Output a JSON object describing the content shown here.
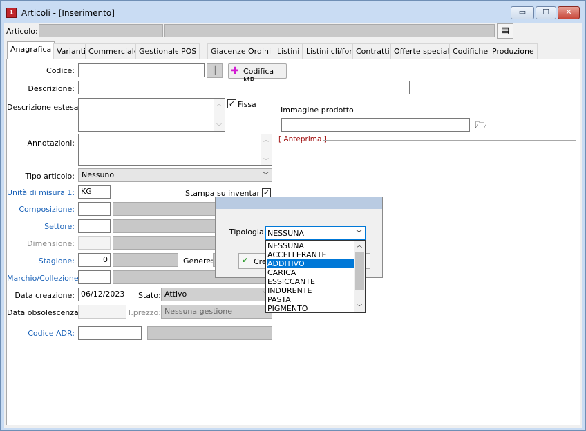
{
  "window": {
    "title": "Articoli - [Inserimento]",
    "app_icon": "1"
  },
  "window_controls": {
    "minimize": "▭",
    "maximize": "☐",
    "close": "✕"
  },
  "top_bar": {
    "label": "Articolo:",
    "list_icon": "clipboard-list-icon"
  },
  "tabs": [
    "Anagrafica",
    "Varianti",
    "Commerciale",
    "Gestionale",
    "POS",
    "Giacenze",
    "Ordini",
    "Listini",
    "Listini cli/for.",
    "Contratti",
    "Offerte speciali",
    "Codifiche",
    "Produzione"
  ],
  "form": {
    "codice_label": "Codice:",
    "codice_value": "",
    "codifica_btn": "Codifica MP",
    "descrizione_label": "Descrizione:",
    "descrizione_estesa_label": "Descrizione estesa:",
    "fissa_label": "Fissa",
    "fissa_checked": "✓",
    "annotazioni_label": "Annotazioni:",
    "tipo_articolo_label": "Tipo articolo:",
    "tipo_articolo_value": "Nessuno",
    "unita_label": "Unità di misura 1:",
    "unita_value": "KG",
    "stampa_label": "Stampa su inventario",
    "stampa_checked": "✓",
    "composizione_label": "Composizione:",
    "settore_label": "Settore:",
    "dimensione_label": "Dimensione:",
    "stagione_label": "Stagione:",
    "stagione_value": "0",
    "genere_label": "Genere:",
    "marchio_label": "Marchio/Collezione:",
    "data_creazione_label": "Data creazione:",
    "data_creazione_value": "06/12/2023",
    "stato_label": "Stato:",
    "stato_value": "Attivo",
    "data_obsolescenza_label": "Data obsolescenza:",
    "tprezzo_label": "T.prezzo:",
    "tprezzo_value": "Nessuna gestione",
    "codice_adr_label": "Codice ADR:"
  },
  "image_panel": {
    "label": "Immagine prodotto",
    "preview_label": "[ Anteprima ]",
    "folder_icon": "folder-open-icon"
  },
  "dialog": {
    "tipologia_label": "Tipologia:",
    "tipologia_value": "NESSUNA",
    "create_btn": "Cre",
    "options": [
      "NESSUNA",
      "ACCELLERANTE",
      "ADDITIVO",
      "CARICA",
      "ESSICCANTE",
      "INDURENTE",
      "PASTA",
      "PIGMENTO"
    ],
    "selected_option": "ADDITIVO"
  },
  "colors": {
    "accent_blue": "#1a62b8",
    "selection": "#0078d7",
    "anteprima_red": "#a01010"
  }
}
